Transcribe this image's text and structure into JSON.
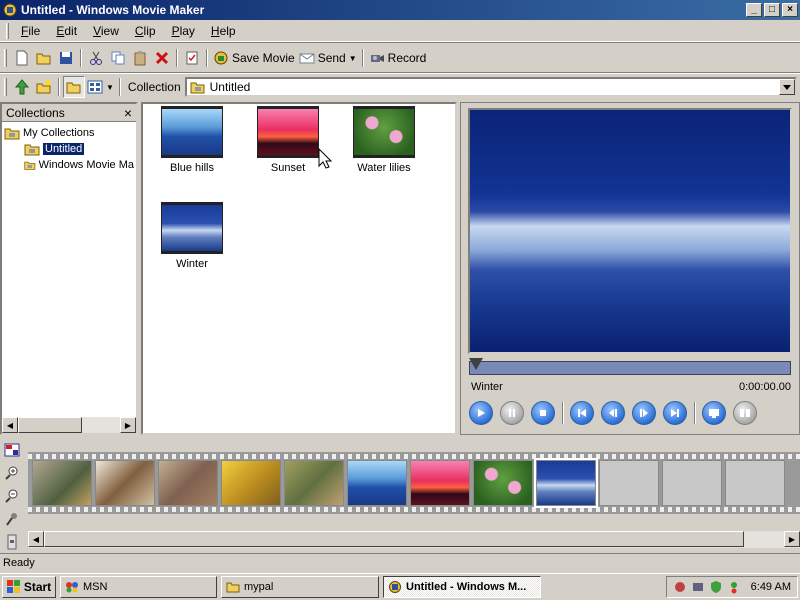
{
  "window": {
    "title": "Untitled - Windows Movie Maker"
  },
  "menu": [
    {
      "accel": "F",
      "rest": "ile"
    },
    {
      "accel": "E",
      "rest": "dit"
    },
    {
      "accel": "V",
      "rest": "iew"
    },
    {
      "accel": "C",
      "rest": "lip"
    },
    {
      "accel": "P",
      "rest": "lay"
    },
    {
      "accel": "H",
      "rest": "elp"
    }
  ],
  "toolbar": {
    "save_movie": "Save Movie",
    "send": "Send",
    "record": "Record",
    "collection_label": "Collection",
    "collection_value": "Untitled"
  },
  "collections": {
    "title": "Collections",
    "root": "My Collections",
    "items": [
      "Untitled",
      "Windows Movie Ma"
    ]
  },
  "clips": [
    {
      "label": "Blue hills"
    },
    {
      "label": "Sunset"
    },
    {
      "label": "Water lilies"
    },
    {
      "label": "Winter"
    }
  ],
  "monitor": {
    "clip_name": "Winter",
    "time": "0:00:00.00",
    "seek_position": 0
  },
  "storyboard": {
    "filled_count": 9,
    "selected_index": 8
  },
  "status": {
    "text": "Ready"
  },
  "taskbar": {
    "start": "Start",
    "tasks": [
      "MSN",
      "mypal",
      "Untitled - Windows M..."
    ],
    "clock": "6:49 AM"
  }
}
